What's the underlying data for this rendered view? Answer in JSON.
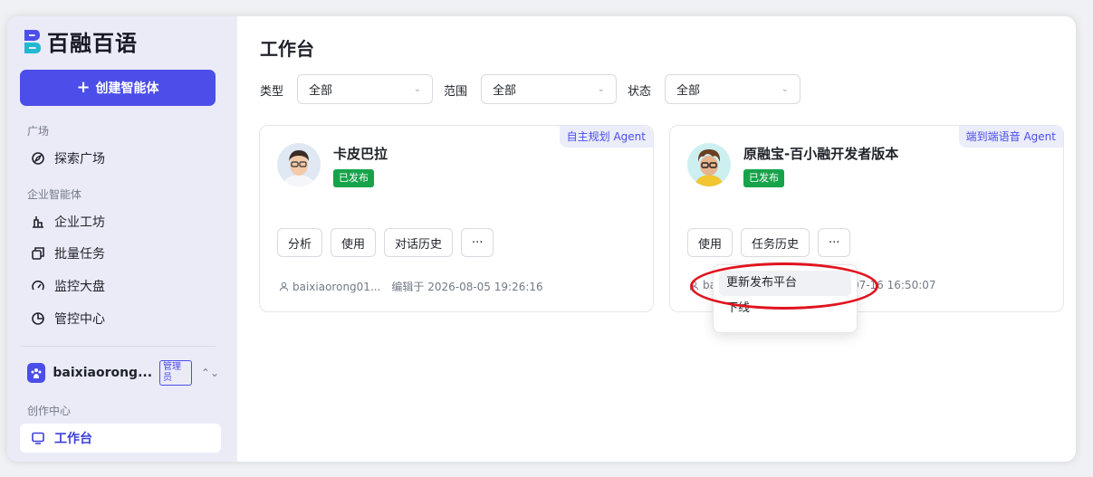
{
  "app": {
    "logo_text": "百融百语",
    "create_button": "创建智能体",
    "create_plus": "+"
  },
  "sidebar": {
    "section_square": "广场",
    "explore": "探索广场",
    "section_enterprise": "企业智能体",
    "workshop": "企业工坊",
    "batch": "批量任务",
    "monitor": "监控大盘",
    "control": "管控中心",
    "user_name": "baixiaorong...",
    "role": "管理员",
    "section_creation": "创作中心",
    "workbench": "工作台"
  },
  "main": {
    "title": "工作台",
    "filters": [
      {
        "label": "类型",
        "value": "全部"
      },
      {
        "label": "范围",
        "value": "全部"
      },
      {
        "label": "状态",
        "value": "全部"
      }
    ]
  },
  "cards": [
    {
      "tag": "自主规划 Agent",
      "name": "卡皮巴拉",
      "status": "已发布",
      "actions": [
        "分析",
        "使用",
        "对话历史",
        "···"
      ],
      "author": "baixiaorong01...",
      "edited": "编辑于 2026-08-05 19:26:16"
    },
    {
      "tag": "端到端语音 Agent",
      "name": "原融宝-百小融开发者版本",
      "status": "已发布",
      "actions": [
        "使用",
        "任务历史",
        "···"
      ],
      "author": "ba",
      "edited": "5-07-16 16:50:07"
    }
  ],
  "dropdown": {
    "items": [
      "更新发布平台",
      "下线"
    ]
  },
  "colors": {
    "accent": "#4b4ee8",
    "published": "#17a34a",
    "highlight": "#e0141e"
  }
}
